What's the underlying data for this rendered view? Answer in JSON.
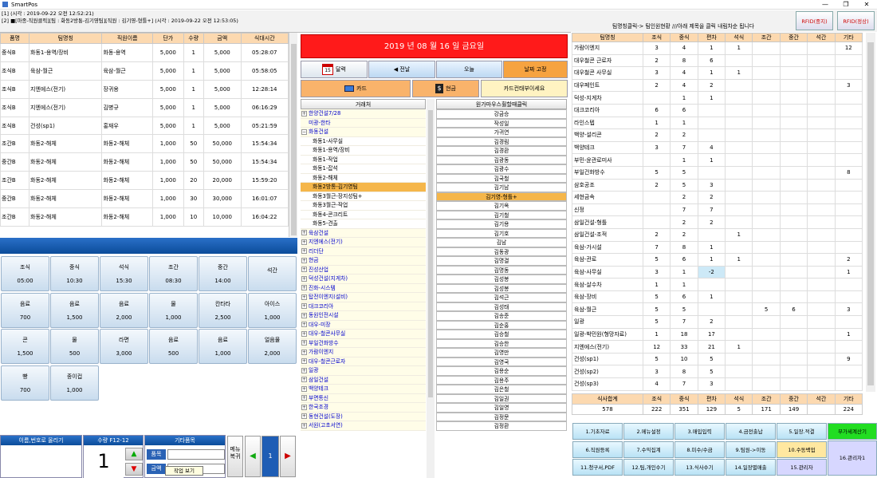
{
  "window": {
    "title": "SmartPos",
    "controls": [
      "—",
      "❐",
      "✕"
    ]
  },
  "info": {
    "line1": "[1] (시각 : 2019-09-22 오전 12:52:21)",
    "line2": "[2] ■[마종-직원클릭][팀 : 화동2방통-김기영팀][직원 : 김기영-형틀+] (시각 : 2019-09-22 오전 12:53:05)"
  },
  "orders": {
    "headers": [
      "품명",
      "팀명칭",
      "직원이름",
      "단가",
      "수량",
      "금액",
      "식대시간"
    ],
    "rows": [
      [
        "중식B",
        "화동1-용역/장비",
        "화동-용역",
        "5,000",
        "1",
        "5,000",
        "05:28:07"
      ],
      [
        "조식B",
        "육삼-월근",
        "육삼-월근",
        "5,000",
        "1",
        "5,000",
        "05:58:05"
      ],
      [
        "조식B",
        "지엔에스(전기)",
        "장귀용",
        "5,000",
        "1",
        "5,000",
        "12:28:14"
      ],
      [
        "조식B",
        "지엔에스(전기)",
        "김병규",
        "5,000",
        "1",
        "5,000",
        "06:16:29"
      ],
      [
        "조식B",
        "건성(sp1)",
        "홍재우",
        "5,000",
        "1",
        "5,000",
        "05:21:59"
      ],
      [
        "조간B",
        "화동2-해체",
        "화동2-해체",
        "1,000",
        "50",
        "50,000",
        "15:54:34"
      ],
      [
        "중간B",
        "화동2-해체",
        "화동2-해체",
        "1,000",
        "50",
        "50,000",
        "15:54:34"
      ],
      [
        "조간B",
        "화동2-해체",
        "화동2-해체",
        "1,000",
        "20",
        "20,000",
        "15:59:20"
      ],
      [
        "중간B",
        "화동2-해체",
        "화동2-해체",
        "1,000",
        "30",
        "30,000",
        "16:01:07"
      ],
      [
        "조간B",
        "화동2-해체",
        "화동2-해체",
        "1,000",
        "10",
        "10,000",
        "16:04:22"
      ]
    ]
  },
  "products": [
    [
      "조식",
      "05:00"
    ],
    [
      "중식",
      "10:30"
    ],
    [
      "석식",
      "15:30"
    ],
    [
      "조간",
      "08:30"
    ],
    [
      "중간",
      "14:00"
    ],
    [
      "석간",
      ""
    ],
    [
      "음료",
      "700"
    ],
    [
      "음료",
      "1,500"
    ],
    [
      "음료",
      "2,000"
    ],
    [
      "물",
      "1,000"
    ],
    [
      "칸타타",
      "2,500"
    ],
    [
      "아이스",
      "1,000"
    ],
    [
      "콘",
      "1,500"
    ],
    [
      "물",
      "500"
    ],
    [
      "라면",
      "3,000"
    ],
    [
      "음료",
      "500"
    ],
    [
      "음료",
      "1,000"
    ],
    [
      "얼음물",
      "2,000"
    ],
    [
      "빵",
      "700"
    ],
    [
      "종이컵",
      "1,000"
    ]
  ],
  "bottom": {
    "name_label": "이름,번호로 올리기",
    "qty_label": "수량 F12-12",
    "qty_value": "1",
    "etc_label": "기타품목",
    "item_btn": "품목",
    "amount_btn": "금액",
    "menu_btn": "메뉴\n복귀",
    "page_value": "1",
    "tooltip": "작업 보기"
  },
  "date": {
    "banner": "2019 년 08 월 16 일 금요일",
    "calendar": "달력",
    "calendar_icon": "15",
    "prev": "◀ 전날",
    "today": "오늘",
    "fix": "날짜 고정",
    "card": "카드",
    "cash": "현금",
    "card_pay": "카드컨태부이세요"
  },
  "tree": {
    "header": "거래처",
    "items": [
      {
        "t": "한양건설7/28",
        "c": false,
        "s": false
      },
      {
        "t": "미광-한타",
        "c": false,
        "s": false,
        "np": true
      },
      {
        "t": "화동건설",
        "c": false,
        "s": false,
        "minus": true
      },
      {
        "t": "화동1-사무실",
        "c": true,
        "s": false
      },
      {
        "t": "화동1-용역/장비",
        "c": true,
        "s": false
      },
      {
        "t": "화동1-작업",
        "c": true,
        "s": false
      },
      {
        "t": "화동1-잡석",
        "c": true,
        "s": false
      },
      {
        "t": "화동2-해체",
        "c": true,
        "s": false
      },
      {
        "t": "화동2방통-김기영팀",
        "c": true,
        "s": true
      },
      {
        "t": "화동3월근-장지성팀+",
        "c": true,
        "s": false
      },
      {
        "t": "화동3월근-작업",
        "c": true,
        "s": false
      },
      {
        "t": "화동4-콘크리트",
        "c": true,
        "s": false
      },
      {
        "t": "화동5-견출",
        "c": true,
        "s": false
      },
      {
        "t": "육삼건설",
        "c": false,
        "s": false
      },
      {
        "t": "지엔에스(전기)",
        "c": false,
        "s": false
      },
      {
        "t": "리더단",
        "c": false,
        "s": false
      },
      {
        "t": "현금",
        "c": false,
        "s": false
      },
      {
        "t": "진성산업",
        "c": false,
        "s": false
      },
      {
        "t": "덕성건설(지게차)",
        "c": false,
        "s": false
      },
      {
        "t": "진화-시스템",
        "c": false,
        "s": false
      },
      {
        "t": "탑전이엔지(설비)",
        "c": false,
        "s": false
      },
      {
        "t": "대크코리아",
        "c": false,
        "s": false
      },
      {
        "t": "동원인전시설",
        "c": false,
        "s": false
      },
      {
        "t": "대우-미장",
        "c": false,
        "s": false
      },
      {
        "t": "대우-철콘사무실",
        "c": false,
        "s": false
      },
      {
        "t": "부일건화방수",
        "c": false,
        "s": false
      },
      {
        "t": "가람이엔지",
        "c": false,
        "s": false
      },
      {
        "t": "대우-철콘근로자",
        "c": false,
        "s": false
      },
      {
        "t": "일광",
        "c": false,
        "s": false
      },
      {
        "t": "삼일건설",
        "c": false,
        "s": false
      },
      {
        "t": "백양테크",
        "c": false,
        "s": false
      },
      {
        "t": "부면통신",
        "c": false,
        "s": false
      },
      {
        "t": "한국조경",
        "c": false,
        "s": false
      },
      {
        "t": "동현건설(도장)",
        "c": false,
        "s": false
      },
      {
        "t": "서원(고초서연)",
        "c": false,
        "s": false
      }
    ]
  },
  "names": {
    "header": "원가마우스휠할때클릭",
    "items": [
      "강금승",
      "작성일",
      "가귀연",
      "김경림",
      "김경환",
      "김광동",
      "김광수",
      "김국철",
      "김기남",
      "김기영-형틀+",
      "김기옥",
      "김기철",
      "김기용",
      "김기호",
      "김남",
      "김동광",
      "김명결",
      "김명동",
      "김성봉",
      "김성봉",
      "김석근",
      "김성태",
      "김송준",
      "김순홍",
      "김승철",
      "김승한",
      "김영만",
      "김영국",
      "김용순",
      "김용주",
      "김은철",
      "김일권",
      "김일영",
      "김정문",
      "김정환"
    ],
    "selected": 9
  },
  "right": {
    "header_text": "팀명칭클릭-> 팀인원현황 ///아래 제목을 클릭 내림차순 됩니다",
    "rfid_stop": "RFID(중지)",
    "rfid_normal": "RFID(정상)",
    "headers": [
      "팀명칭",
      "조식",
      "중식",
      "편차",
      "석식",
      "조간",
      "중간",
      "석간",
      "기타"
    ],
    "rows": [
      [
        "가람이엔지",
        "3",
        "4",
        "1",
        "1",
        "",
        "",
        "",
        "12"
      ],
      [
        "대우철콘 근로자",
        "2",
        "8",
        "6",
        "",
        "",
        "",
        "",
        ""
      ],
      [
        "대우철콘 사무실",
        "3",
        "4",
        "1",
        "1",
        "",
        "",
        "",
        ""
      ],
      [
        "대우페인트",
        "2",
        "4",
        "2",
        "",
        "",
        "",
        "",
        "3"
      ],
      [
        "덕성-지게차",
        "",
        "1",
        "1",
        "",
        "",
        "",
        "",
        ""
      ],
      [
        "대크코리아",
        "6",
        "6",
        "",
        "",
        "",
        "",
        "",
        ""
      ],
      [
        "라인스텝",
        "1",
        "1",
        "",
        "",
        "",
        "",
        "",
        ""
      ],
      [
        "백양-설리콘",
        "2",
        "2",
        "",
        "",
        "",
        "",
        "",
        ""
      ],
      [
        "백양테크",
        "3",
        "7",
        "4",
        "",
        "",
        "",
        "",
        ""
      ],
      [
        "부민-윤관로미사",
        "",
        "1",
        "1",
        "",
        "",
        "",
        "",
        ""
      ],
      [
        "부일건화방수",
        "5",
        "5",
        "",
        "",
        "",
        "",
        "",
        "8"
      ],
      [
        "삼호공조",
        "2",
        "5",
        "3",
        "",
        "",
        "",
        "",
        ""
      ],
      [
        "세현금속",
        "",
        "2",
        "2",
        "",
        "",
        "",
        "",
        ""
      ],
      [
        "신정",
        "",
        "7",
        "7",
        "",
        "",
        "",
        "",
        ""
      ],
      [
        "삼일건설-형틀",
        "",
        "2",
        "2",
        "",
        "",
        "",
        "",
        ""
      ],
      [
        "삼일건설-조적",
        "2",
        "2",
        "",
        "1",
        "",
        "",
        "",
        ""
      ],
      [
        "육삼-가시설",
        "7",
        "8",
        "1",
        "",
        "",
        "",
        "",
        ""
      ],
      [
        "육삼-관로",
        "5",
        "6",
        "1",
        "1",
        "",
        "",
        "",
        "2"
      ],
      [
        "육삼-사무실",
        "3",
        "1",
        "-2",
        "",
        "",
        "",
        "",
        "1"
      ],
      [
        "육삼-살수차",
        "1",
        "1",
        "",
        "",
        "",
        "",
        "",
        ""
      ],
      [
        "육삼-장비",
        "5",
        "6",
        "1",
        "",
        "",
        "",
        "",
        ""
      ],
      [
        "육삼-월근",
        "5",
        "5",
        "",
        "",
        "5",
        "6",
        "",
        "3"
      ],
      [
        "일광",
        "5",
        "7",
        "2",
        "",
        "",
        "",
        "",
        ""
      ],
      [
        "일광-박민원(형망자료)",
        "1",
        "18",
        "17",
        "",
        "",
        "",
        "",
        "1"
      ],
      [
        "지엔에스(전기)",
        "12",
        "33",
        "21",
        "1",
        "",
        "",
        "",
        ""
      ],
      [
        "건성(sp1)",
        "5",
        "10",
        "5",
        "",
        "",
        "",
        "",
        "9"
      ],
      [
        "건성(sp2)",
        "3",
        "8",
        "5",
        "",
        "",
        "",
        "",
        ""
      ],
      [
        "건성(sp3)",
        "4",
        "7",
        "3",
        "",
        "",
        "",
        "",
        ""
      ]
    ],
    "totals_headers": [
      "식사합계",
      "조식",
      "중식",
      "편차",
      "석식",
      "조간",
      "중간",
      "석간",
      "기타"
    ],
    "totals": [
      "578",
      "222",
      "351",
      "129",
      "5",
      "171",
      "149",
      "",
      "224"
    ]
  },
  "functions": [
    [
      "1.기초자료",
      "2.메뉴설정",
      "3.매입입력",
      "4.금전출납",
      "5.일장.적결",
      "부가세계산기"
    ],
    [
      "6.직원등록",
      "7.수익집계",
      "8.미수/수금",
      "9.팀원->이동",
      "10.수동백업"
    ],
    [
      "11.청구서,PDF",
      "12.팀,개인수기",
      "13.식사수기",
      "14.일장별매출",
      "15.관리자",
      "16.관리자1"
    ]
  ],
  "colors": {
    "accent_blue": "#0b4c9a",
    "date_red": "#ff1a1a",
    "header_peach": "#fcd9b0",
    "selected_orange": "#f5b64a",
    "function_green": "#22dd22",
    "function_orange": "#ffe8a0",
    "function_lavender": "#d7d7ff"
  }
}
